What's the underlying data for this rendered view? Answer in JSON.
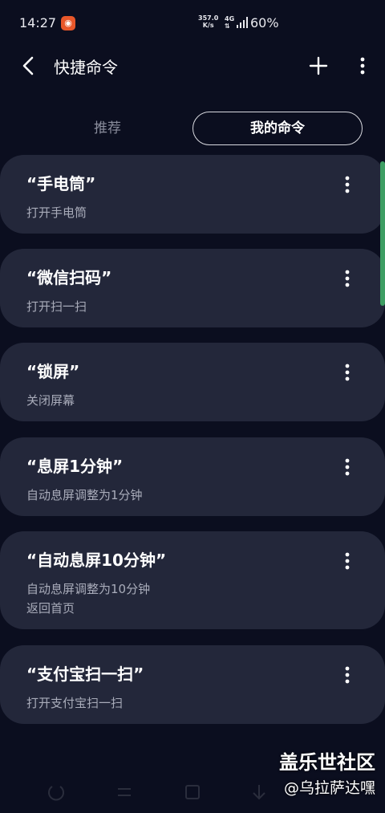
{
  "status_bar": {
    "time": "14:27",
    "net_speed_value": "357.0",
    "net_speed_unit": "K/s",
    "network_type": "4G",
    "battery": "60%"
  },
  "app_bar": {
    "title": "快捷命令"
  },
  "tabs": [
    {
      "label": "推荐",
      "selected": false
    },
    {
      "label": "我的命令",
      "selected": true
    }
  ],
  "commands": [
    {
      "name": "“手电筒”",
      "actions": [
        "打开手电筒"
      ]
    },
    {
      "name": "“微信扫码”",
      "actions": [
        "打开扫一扫"
      ]
    },
    {
      "name": "“锁屏”",
      "actions": [
        "关闭屏幕"
      ]
    },
    {
      "name": "“息屏1分钟”",
      "actions": [
        "自动息屏调整为1分钟"
      ]
    },
    {
      "name": "“自动息屏10分钟”",
      "actions": [
        "自动息屏调整为10分钟",
        "返回首页"
      ]
    },
    {
      "name": "“支付宝扫一扫”",
      "actions": [
        "打开支付宝扫一扫"
      ]
    }
  ],
  "watermark": {
    "title": "盖乐世社区",
    "user": "@乌拉萨达嘿"
  },
  "colors": {
    "background": "#0b0e1f",
    "card": "#23273a",
    "scroll_accent": "#3d9e63",
    "notification": "#e8572a"
  },
  "icons": [
    "back-icon",
    "plus-icon",
    "more-vertical-icon",
    "power-icon",
    "switch-icon",
    "square-icon",
    "down-arrow-icon"
  ]
}
